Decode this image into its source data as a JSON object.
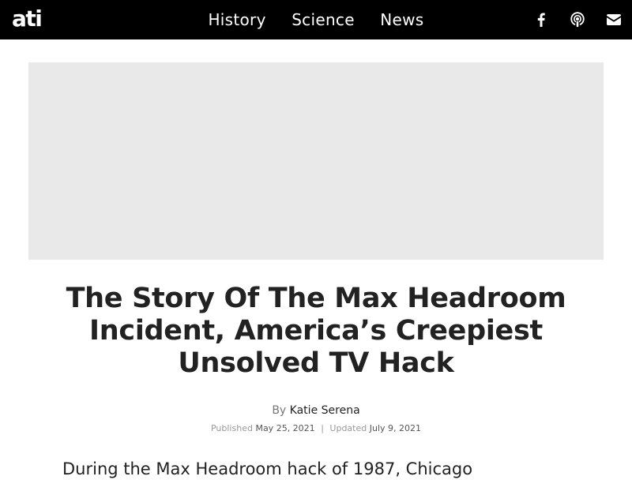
{
  "header": {
    "logo": "ati",
    "nav": [
      "History",
      "Science",
      "News"
    ],
    "social_icons": [
      "facebook-icon",
      "podcast-icon",
      "email-icon"
    ],
    "colors": {
      "background": "#000000",
      "text": "#ffffff"
    }
  },
  "hero": {
    "background": "#e9e9e9"
  },
  "article": {
    "title": "The Story Of The Max Headroom Incident, America’s Creepiest Unsolved TV Hack",
    "by_label": "By",
    "author": "Katie Serena",
    "published_label": "Published",
    "published_date": "May 25, 2021",
    "separator": "|",
    "updated_label": "Updated",
    "updated_date": "July 9, 2021",
    "lede": "During the Max Headroom hack of 1987, Chicago"
  }
}
